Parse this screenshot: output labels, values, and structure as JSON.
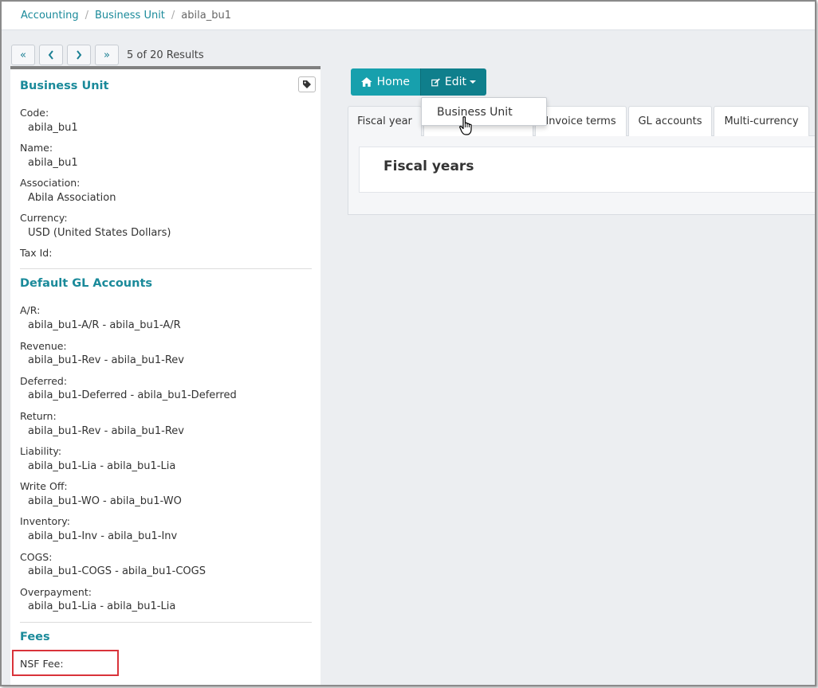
{
  "breadcrumb": {
    "items": [
      {
        "label": "Accounting",
        "link": true
      },
      {
        "label": "Business Unit",
        "link": true
      },
      {
        "label": "abila_bu1",
        "link": false
      }
    ],
    "separator": "/"
  },
  "pager": {
    "first": "«",
    "prev": "‹",
    "next": "›",
    "last": "»",
    "results_text": "5 of 20 Results"
  },
  "business_unit": {
    "title": "Business Unit",
    "fields": [
      {
        "label": "Code:",
        "value": "abila_bu1"
      },
      {
        "label": "Name:",
        "value": "abila_bu1"
      },
      {
        "label": "Association:",
        "value": "Abila Association"
      },
      {
        "label": "Currency:",
        "value": "USD (United States Dollars)"
      },
      {
        "label": "Tax Id:",
        "value": ""
      }
    ]
  },
  "default_gl": {
    "title": "Default GL Accounts",
    "fields": [
      {
        "label": "A/R:",
        "value": "abila_bu1-A/R - abila_bu1-A/R"
      },
      {
        "label": "Revenue:",
        "value": "abila_bu1-Rev - abila_bu1-Rev"
      },
      {
        "label": "Deferred:",
        "value": "abila_bu1-Deferred - abila_bu1-Deferred"
      },
      {
        "label": "Return:",
        "value": "abila_bu1-Rev - abila_bu1-Rev"
      },
      {
        "label": "Liability:",
        "value": "abila_bu1-Lia - abila_bu1-Lia"
      },
      {
        "label": "Write Off:",
        "value": "abila_bu1-WO - abila_bu1-WO"
      },
      {
        "label": "Inventory:",
        "value": "abila_bu1-Inv - abila_bu1-Inv"
      },
      {
        "label": "COGS:",
        "value": "abila_bu1-COGS - abila_bu1-COGS"
      },
      {
        "label": "Overpayment:",
        "value": "abila_bu1-Lia - abila_bu1-Lia"
      }
    ]
  },
  "fees": {
    "title": "Fees",
    "nsf_label": "NSF Fee:"
  },
  "toolbar": {
    "home_label": "Home",
    "edit_label": "Edit"
  },
  "dropdown": {
    "items": [
      "Business Unit"
    ]
  },
  "tabs": [
    {
      "label": "Fiscal year",
      "active": true
    },
    {
      "label": "",
      "active": false
    },
    {
      "label": "Invoice terms",
      "active": false
    },
    {
      "label": "GL accounts",
      "active": false
    },
    {
      "label": "Multi-currency",
      "active": false
    }
  ],
  "content": {
    "title": "Fiscal years"
  },
  "colors": {
    "accent": "#1a8a9a",
    "home_button": "#17a0ad",
    "edit_button": "#0f7f8c",
    "highlight": "#d9333a"
  }
}
